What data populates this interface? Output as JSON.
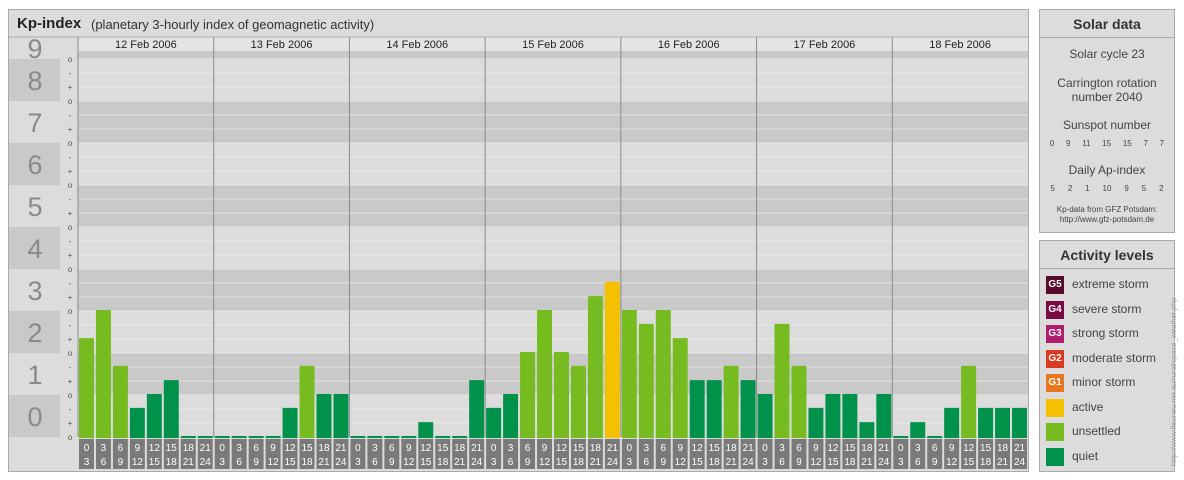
{
  "header": {
    "title": "Kp-index",
    "subtitle": "(planetary 3-hourly index of geomagnetic activity)"
  },
  "chart_data": {
    "type": "bar",
    "y_axis_labels": [
      "0",
      "1",
      "2",
      "3",
      "4",
      "5",
      "6",
      "7",
      "8",
      "9"
    ],
    "y_sub_labels": [
      "+",
      "-",
      "o"
    ],
    "ylim": [
      0,
      9.33
    ],
    "days": [
      "12 Feb 2006",
      "13 Feb 2006",
      "14 Feb 2006",
      "15 Feb 2006",
      "16 Feb 2006",
      "17 Feb 2006",
      "18 Feb 2006"
    ],
    "interval_start_labels": [
      "0",
      "3",
      "6",
      "9",
      "12",
      "15",
      "18",
      "21"
    ],
    "interval_end_labels": [
      "3",
      "6",
      "9",
      "12",
      "15",
      "18",
      "21",
      "24"
    ],
    "values": [
      [
        2.33,
        3.0,
        1.67,
        0.67,
        1.0,
        1.33,
        0.0,
        0.0
      ],
      [
        0.0,
        0.0,
        0.0,
        0.0,
        0.67,
        1.67,
        1.0,
        1.0
      ],
      [
        0.0,
        0.0,
        0.0,
        0.0,
        0.33,
        0.0,
        0.0,
        1.33
      ],
      [
        0.67,
        1.0,
        2.0,
        3.0,
        2.0,
        1.67,
        3.33,
        3.67
      ],
      [
        3.0,
        2.67,
        3.0,
        2.33,
        1.33,
        1.33,
        1.67,
        1.33
      ],
      [
        1.0,
        2.67,
        1.67,
        0.67,
        1.0,
        1.0,
        0.33,
        1.0
      ],
      [
        0.0,
        0.33,
        0.0,
        0.67,
        1.67,
        0.67,
        0.67,
        0.67
      ]
    ],
    "level_colors": {
      "quiet": "#00914b",
      "unsettled": "#76bb1f",
      "active": "#f5c000"
    }
  },
  "solar": {
    "title": "Solar data",
    "cycle": "Solar cycle 23",
    "carrington_line1": "Carrington rotation",
    "carrington_line2": "number 2040",
    "sunspot_label": "Sunspot number",
    "sunspot_values": [
      "0",
      "9",
      "11",
      "15",
      "15",
      "7",
      "7"
    ],
    "ap_label": "Daily Ap-index",
    "ap_values": [
      "5",
      "2",
      "1",
      "10",
      "9",
      "5",
      "2"
    ],
    "source_line1": "Kp-data from GFZ Potsdam:",
    "source_line2": "http://www.gfz-potsdam.de"
  },
  "levels": {
    "title": "Activity levels",
    "items": [
      {
        "badge": "G5",
        "label": "extreme storm",
        "color": "#5a0a2e"
      },
      {
        "badge": "G4",
        "label": "severe storm",
        "color": "#7a0a45"
      },
      {
        "badge": "G3",
        "label": "strong storm",
        "color": "#b01c6e"
      },
      {
        "badge": "G2",
        "label": "moderate storm",
        "color": "#d83a20"
      },
      {
        "badge": "G1",
        "label": "minor storm",
        "color": "#e8761c"
      },
      {
        "badge": "",
        "label": "active",
        "color": "#f5c000"
      },
      {
        "badge": "",
        "label": "unsettled",
        "color": "#76bb1f"
      },
      {
        "badge": "",
        "label": "quiet",
        "color": "#00914b"
      }
    ]
  },
  "credit": "http://www.fleurieu.net.au/rural/space_weather.php"
}
